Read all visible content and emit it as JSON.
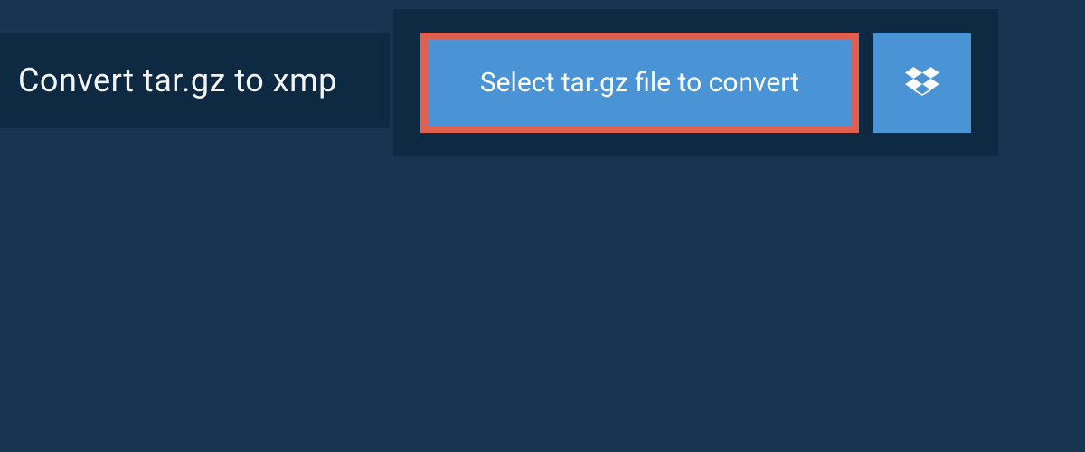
{
  "header": {
    "title": "Convert tar.gz to xmp"
  },
  "upload": {
    "select_label": "Select tar.gz file to convert",
    "dropbox_icon": "dropbox-icon"
  },
  "colors": {
    "background": "#173450",
    "panel": "#0e2a42",
    "button": "#4a94d6",
    "button_border": "#e0604f",
    "text_light": "#ffffff"
  }
}
